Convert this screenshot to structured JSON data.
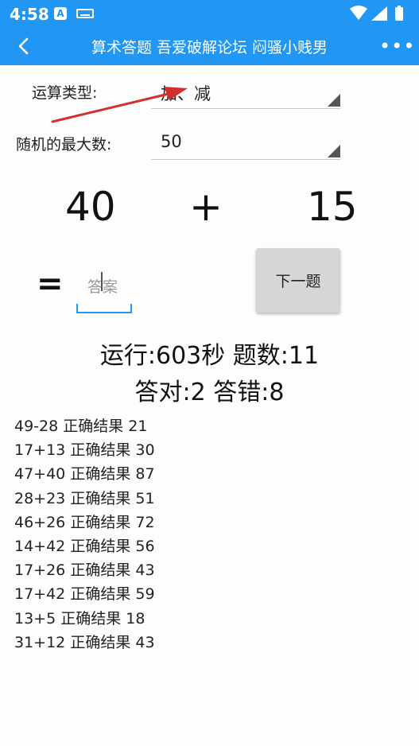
{
  "status_bar": {
    "time": "4:58",
    "notification_icon": "A"
  },
  "app_bar": {
    "title": "算术答题 吾爱破解论坛 闷骚小贱男",
    "more": "•••"
  },
  "form": {
    "op_type_label": "运算类型:",
    "op_type_value": "加、减",
    "max_label": "随机的最大数:",
    "max_value": "50"
  },
  "problem": {
    "left": "40",
    "operator": "+",
    "right": "15",
    "equals": "=",
    "answer_placeholder": "答案",
    "next_button": "下一题"
  },
  "stats": {
    "line1": "运行:603秒 题数:11",
    "line2": "答对:2 答错:8"
  },
  "history": [
    "49-28  正确结果 21",
    "17+13  正确结果 30",
    "47+40  正确结果 87",
    "28+23  正确结果 51",
    "46+26  正确结果 72",
    "14+42  正确结果 56",
    "17+26  正确结果 43",
    "17+42  正确结果 59",
    "13+5  正确结果 18",
    "31+12  正确结果 43"
  ],
  "colors": {
    "primary": "#2196f3",
    "annotation_arrow": "#d32f2f",
    "button_bg": "#d6d6d6"
  },
  "icons": {
    "back": "chevron-left-icon",
    "more": "more-dots-icon",
    "wifi": "wifi-icon",
    "signal": "signal-icon",
    "battery": "battery-icon",
    "keyboard": "keyboard-icon"
  }
}
